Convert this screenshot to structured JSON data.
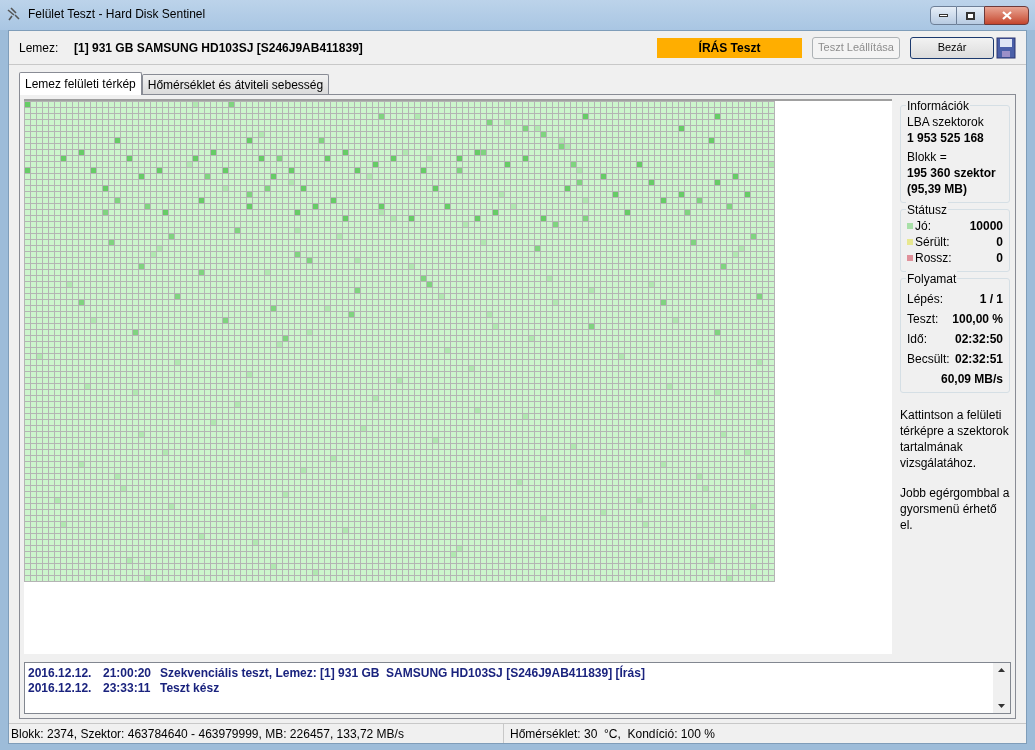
{
  "window": {
    "title": "Felület Teszt - Hard Disk Sentinel"
  },
  "disk": {
    "label": "Lemez:",
    "value": "[1] 931 GB  SAMSUNG HD103SJ [S246J9AB411839]"
  },
  "mode_badge": "ÍRÁS Teszt",
  "buttons": [
    {
      "label": "Teszt Leállítása",
      "disabled": true
    },
    {
      "label": "Bezár",
      "disabled": false
    }
  ],
  "tabs": [
    {
      "label": "Lemez felületi térkép",
      "selected": true
    },
    {
      "label": "Hőmérséklet és átviteli sebesség",
      "selected": false
    }
  ],
  "info": {
    "title": "Információk",
    "lba_label": "LBA szektorok",
    "lba_value": "1 953 525 168",
    "block_label": "Blokk =",
    "block_value": "195 360 szektor",
    "block_size": "(95,39 MB)"
  },
  "status": {
    "title": "Státusz",
    "items": [
      {
        "label": "Jó:",
        "value": "10000",
        "color": "#a8e0a8"
      },
      {
        "label": "Sérült:",
        "value": "0",
        "color": "#e8e890"
      },
      {
        "label": "Rossz:",
        "value": "0",
        "color": "#e0909a"
      }
    ]
  },
  "progress": {
    "title": "Folyamat",
    "rows": [
      {
        "label": "Lépés:",
        "value": "1 / 1"
      },
      {
        "label": "Teszt:",
        "value": "100,00 %"
      },
      {
        "label": "Idő:",
        "value": "02:32:50"
      },
      {
        "label": "Becsült:",
        "value": "02:32:51"
      }
    ],
    "speed": "60,09 MB/s"
  },
  "hints": [
    "Kattintson a felületi térképre a szektorok tartalmának vizsgálatához.",
    "Jobb egérgombbal a gyorsmenü érhető el."
  ],
  "log": [
    {
      "date": "2016.12.12.",
      "time": "21:00:20",
      "message": "Szekvenciális teszt, Lemez: [1] 931 GB  SAMSUNG HD103SJ [S246J9AB411839] [Írás]"
    },
    {
      "date": "2016.12.12.",
      "time": "23:33:11",
      "message": "Teszt kész"
    }
  ],
  "status_bar": [
    "Blokk: 2374, Szektor: 463784640 - 463979999, MB: 226457, 133,72 MB/s",
    "Hőmérséklet: 30  °C,  Kondíció: 100 %"
  ]
}
